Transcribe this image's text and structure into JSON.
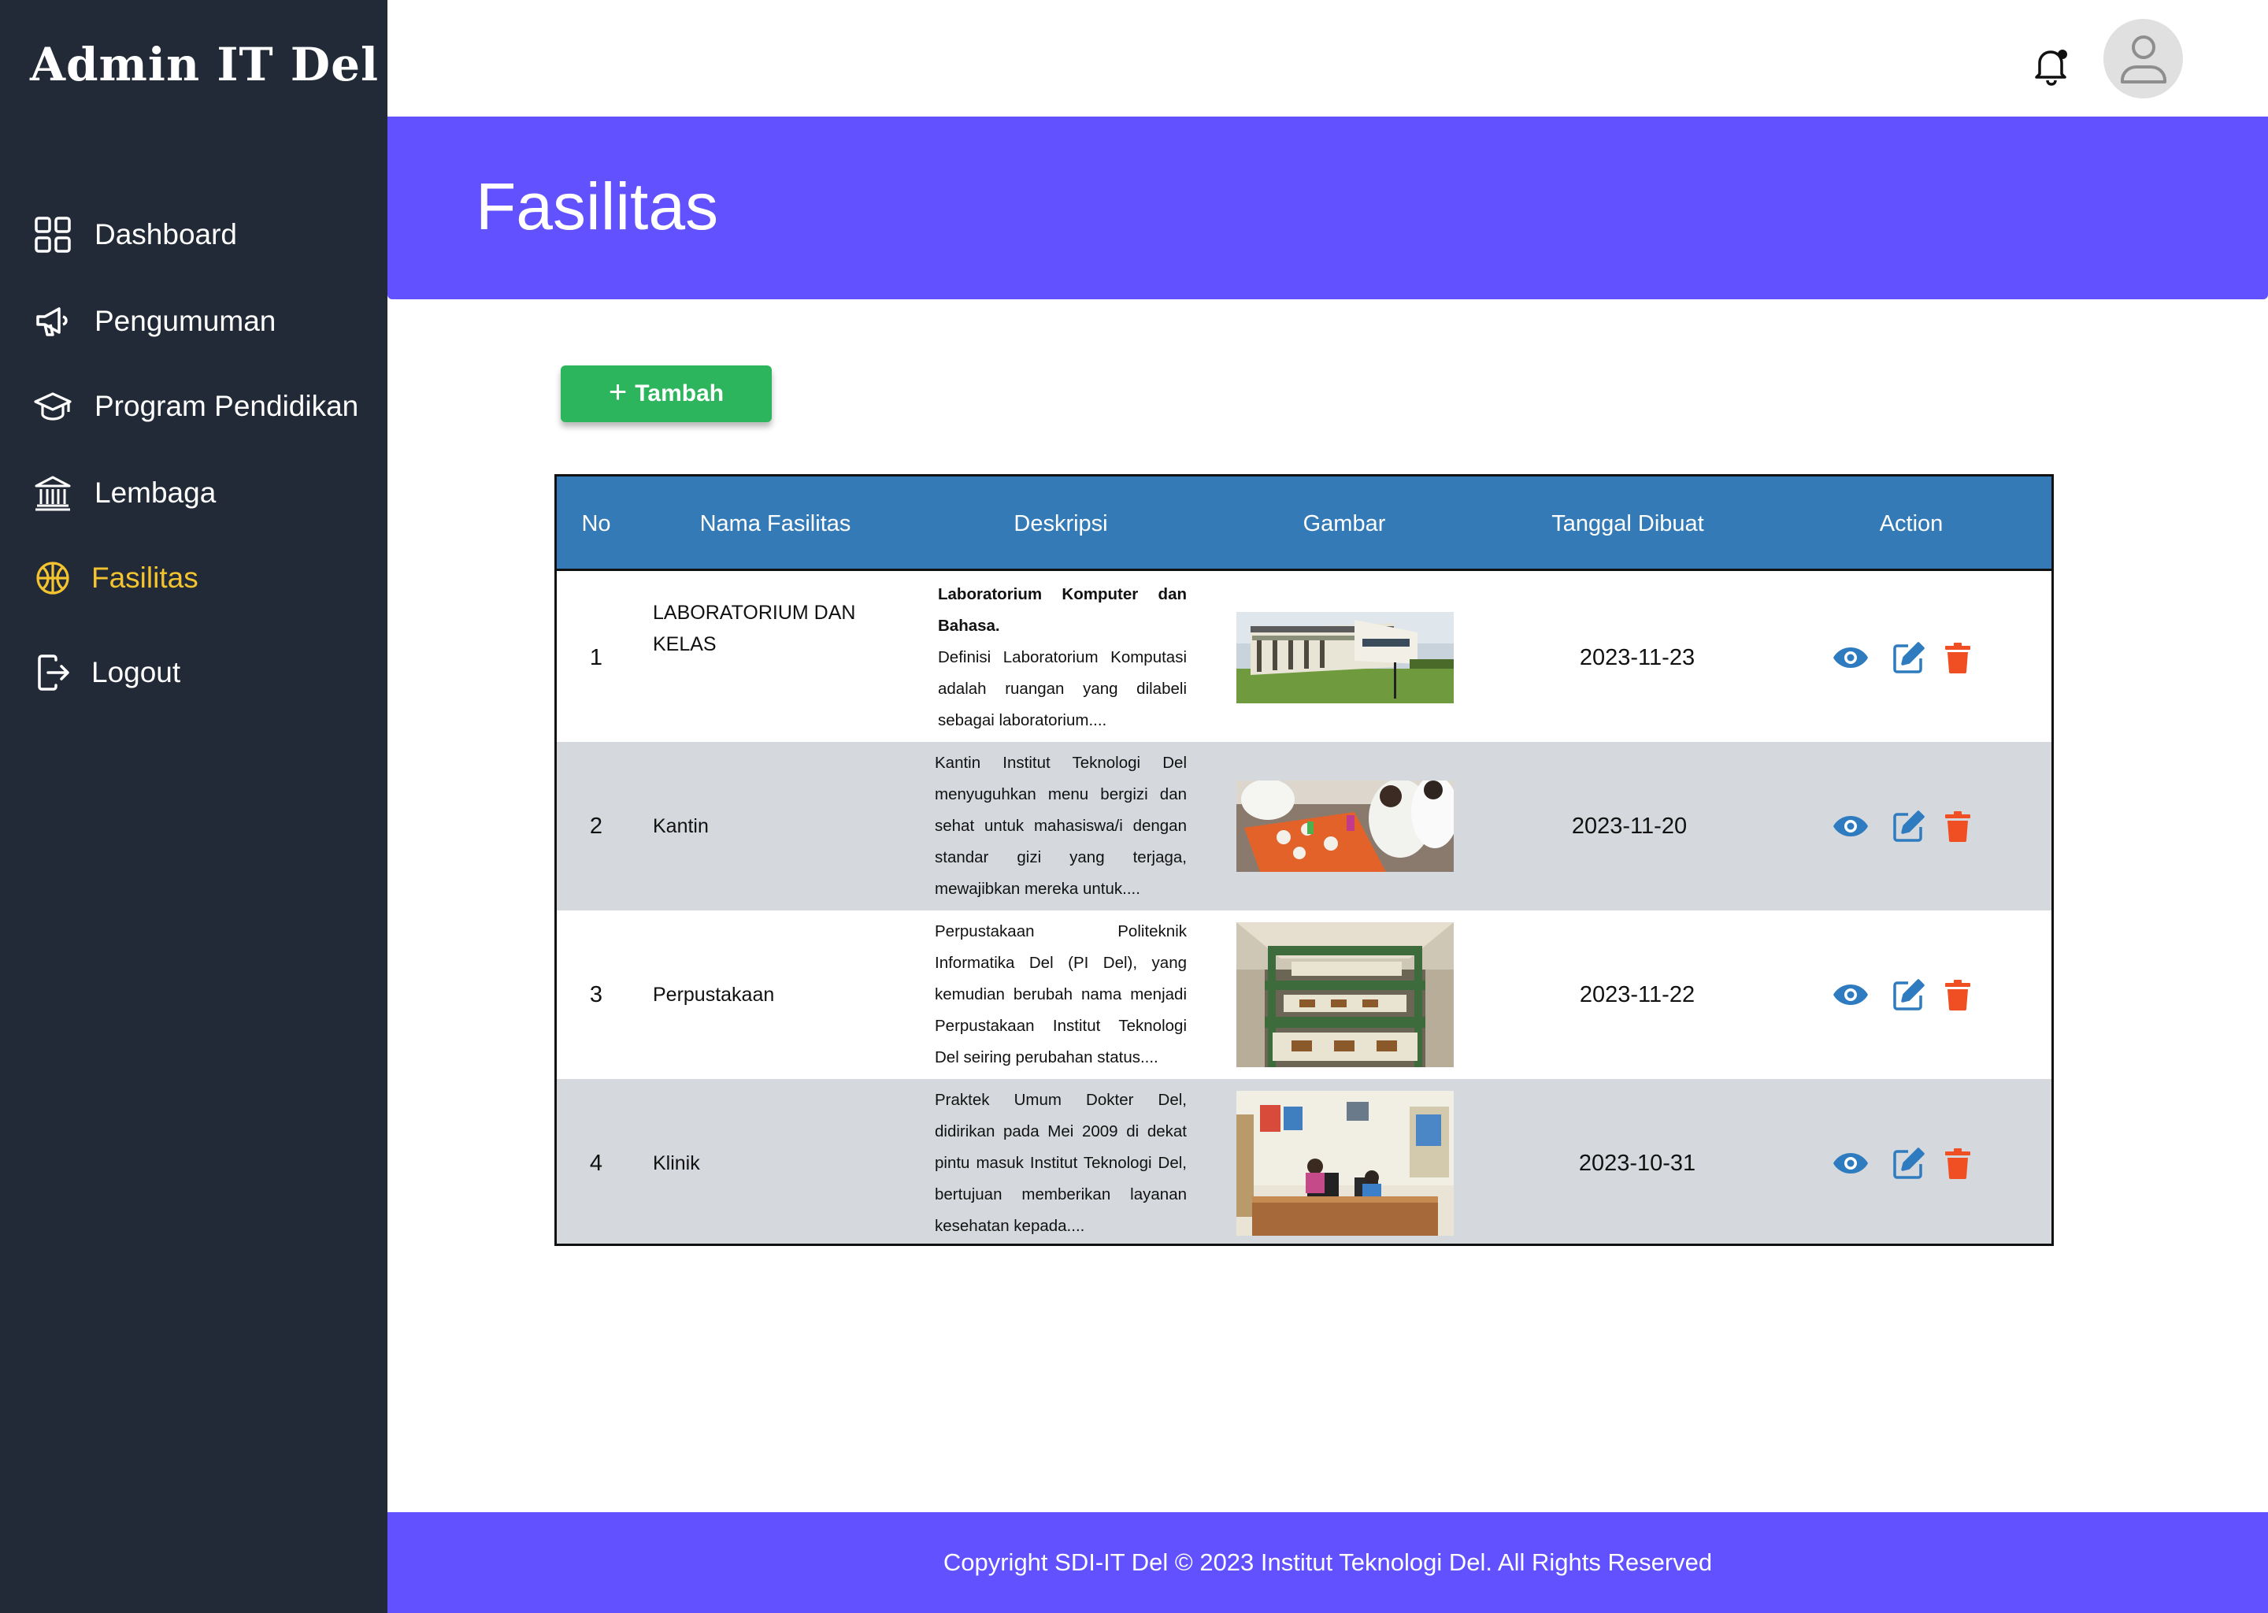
{
  "app": {
    "brand": "Admin IT Del"
  },
  "sidebar": {
    "items": [
      {
        "label": "Dashboard",
        "icon": "grid-icon"
      },
      {
        "label": "Pengumuman",
        "icon": "megaphone-icon"
      },
      {
        "label": "Program Pendidikan",
        "icon": "graduation-cap-icon"
      },
      {
        "label": "Lembaga",
        "icon": "building-columns-icon"
      },
      {
        "label": "Fasilitas",
        "icon": "basketball-icon",
        "active": true
      },
      {
        "label": "Logout",
        "icon": "logout-icon"
      }
    ],
    "active_color": "#f4c430"
  },
  "header": {
    "title": "Fasilitas"
  },
  "toolbar": {
    "add_label": "Tambah",
    "add_icon": "plus-icon"
  },
  "table": {
    "headers": [
      "No",
      "Nama Fasilitas",
      "Deskripsi",
      "Gambar",
      "Tanggal Dibuat",
      "Action"
    ],
    "rows": [
      {
        "no": "1",
        "name": "LABORATORIUM DAN KELAS",
        "desc_bold": "Laboratorium Komputer dan Bahasa.",
        "desc": "Definisi Laboratorium Komputasi adalah ruangan yang dilabeli sebagai laboratorium....",
        "image_alt": "building-photo",
        "date": "2023-11-23"
      },
      {
        "no": "2",
        "name": "Kantin",
        "desc_bold": "",
        "desc": "Kantin Institut Teknologi Del menyuguhkan menu bergizi dan sehat untuk mahasiswa/i dengan standar gizi yang terjaga, mewajibkan mereka untuk....",
        "image_alt": "canteen-photo",
        "date": "2023-11-20"
      },
      {
        "no": "3",
        "name": "Perpustakaan",
        "desc_bold": "",
        "desc": "Perpustakaan Politeknik Informatika Del (PI Del), yang kemudian berubah nama menjadi Perpustakaan Institut Teknologi Del seiring perubahan status....",
        "image_alt": "library-photo",
        "date": "2023-11-22"
      },
      {
        "no": "4",
        "name": "Klinik",
        "desc_bold": "",
        "desc": "Praktek Umum Dokter Del, didirikan pada Mei 2009 di dekat pintu masuk Institut Teknologi Del, bertujuan memberikan layanan kesehatan kepada....",
        "image_alt": "clinic-photo",
        "date": "2023-10-31"
      }
    ],
    "action_icons": [
      "eye-icon",
      "edit-icon",
      "trash-icon"
    ]
  },
  "footer": {
    "text": "Copyright SDI-IT Del © 2023 Institut Teknologi Del. All Rights Reserved"
  },
  "colors": {
    "sidebar": "#212a36",
    "header": "#6251fe",
    "table_head": "#337ab7",
    "add_button": "#2db55d",
    "view": "#2f7bbf",
    "delete": "#f04e23"
  }
}
